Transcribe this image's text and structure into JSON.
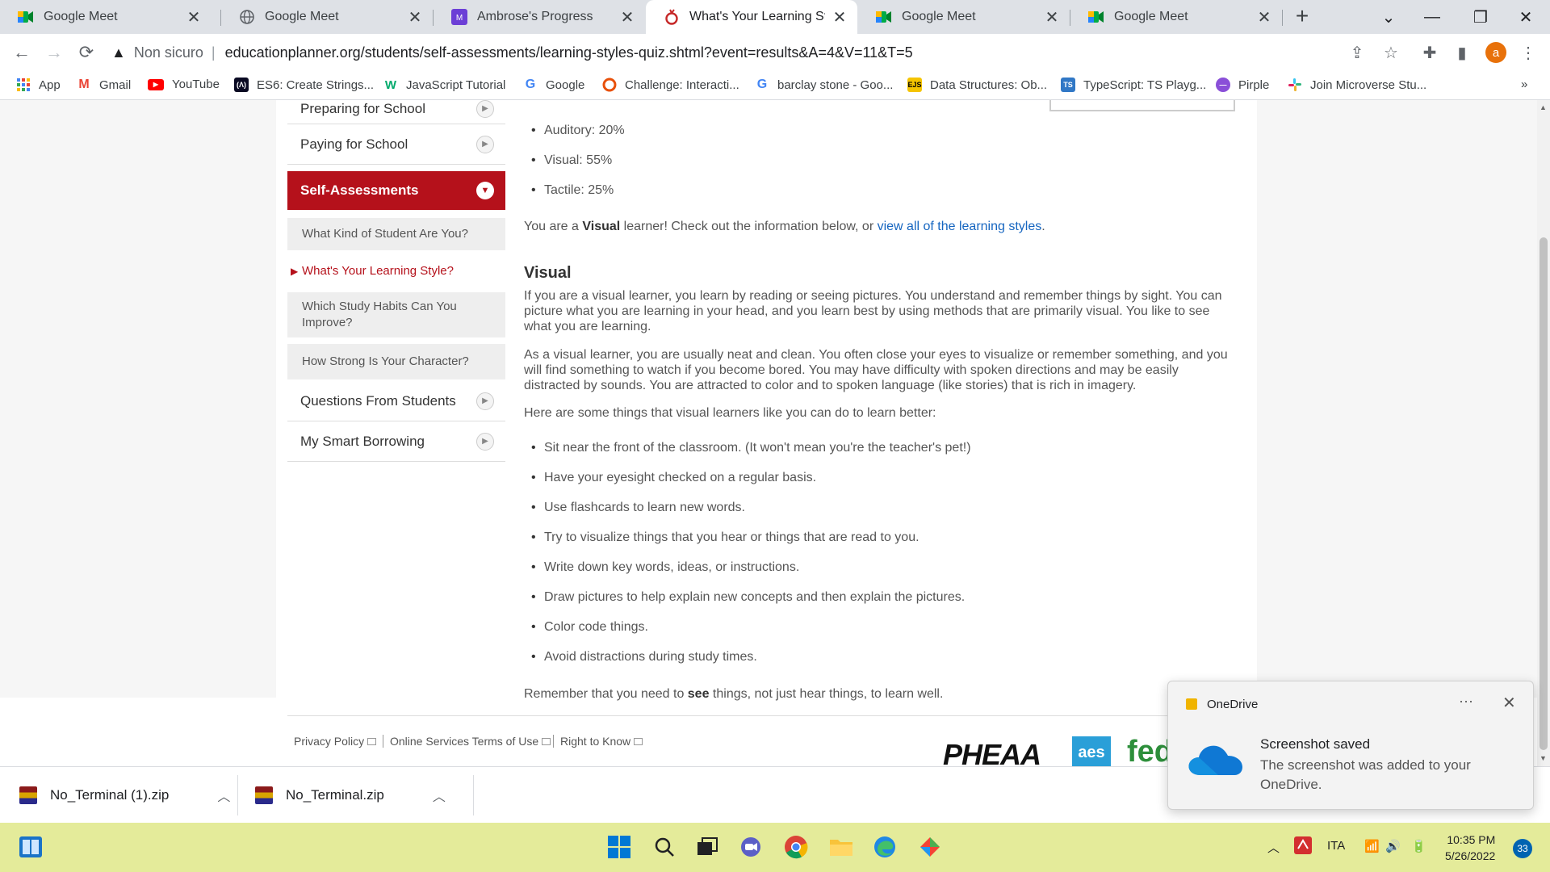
{
  "browser": {
    "tabs": [
      {
        "title": "Google Meet",
        "icon": "google-meet-icon"
      },
      {
        "title": "Google Meet",
        "icon": "globe-icon"
      },
      {
        "title": "Ambrose's Progress",
        "icon": "mm-icon"
      },
      {
        "title": "What's Your Learning Style?",
        "icon": "educationplanner-icon",
        "active": true
      },
      {
        "title": "Google Meet",
        "icon": "google-meet-icon"
      },
      {
        "title": "Google Meet",
        "icon": "google-meet-icon"
      }
    ],
    "security_label": "Non sicuro",
    "url": "educationplanner.org/students/self-assessments/learning-styles-quiz.shtml?event=results&A=4&V=11&T=5",
    "profile_initial": "a",
    "bookmarks": [
      {
        "label": "App",
        "icon": "apps-grid-icon"
      },
      {
        "label": "Gmail",
        "icon": "gmail-icon"
      },
      {
        "label": "YouTube",
        "icon": "youtube-icon"
      },
      {
        "label": "ES6: Create Strings...",
        "icon": "freecodecamp-icon"
      },
      {
        "label": "JavaScript Tutorial",
        "icon": "w3schools-icon"
      },
      {
        "label": "Google",
        "icon": "google-icon"
      },
      {
        "label": "Challenge: Interacti...",
        "icon": "khan-icon"
      },
      {
        "label": "barclay stone - Goo...",
        "icon": "google-icon"
      },
      {
        "label": "Data Structures: Ob...",
        "icon": "ejs-icon"
      },
      {
        "label": "TypeScript: TS Playg...",
        "icon": "typescript-icon"
      },
      {
        "label": "Pirple",
        "icon": "pirple-icon"
      },
      {
        "label": "Join Microverse Stu...",
        "icon": "slack-icon"
      }
    ],
    "bookmarks_overflow": "»"
  },
  "sidebar": {
    "items": [
      {
        "label": "Preparing for School"
      },
      {
        "label": "Paying for School"
      },
      {
        "label": "Self-Assessments",
        "active": true
      }
    ],
    "sub_items": [
      {
        "label": "What Kind of Student Are You?"
      },
      {
        "label": "What's Your Learning Style?",
        "current": true
      },
      {
        "label": "Which Study Habits Can You Improve?"
      },
      {
        "label": "How Strong Is Your Character?"
      }
    ],
    "after_items": [
      {
        "label": "Questions From Students"
      },
      {
        "label": "My Smart Borrowing"
      }
    ]
  },
  "results": {
    "scores": [
      "Auditory: 20%",
      "Visual: 55%",
      "Tactile: 25%"
    ],
    "summary_pre": "You are a ",
    "summary_bold": "Visual",
    "summary_mid": " learner! Check out the information below, or ",
    "summary_link": "view all of the learning styles",
    "summary_post": "."
  },
  "visual": {
    "heading": "Visual",
    "p1": "If you are a visual learner, you learn by reading or seeing pictures. You understand and remember things by sight. You can picture what you are learning in your head, and you learn best by using methods that are primarily visual. You like to see what you are learning.",
    "p2": "As a visual learner, you are usually neat and clean. You often close your eyes to visualize or remember something, and you will find something to watch if you become bored. You may have difficulty with spoken directions and may be easily distracted by sounds. You are attracted to color and to spoken language (like stories) that is rich in imagery.",
    "p3": "Here are some things that visual learners like you can do to learn better:",
    "tips": [
      "Sit near the front of the classroom. (It won't mean you're the teacher's pet!)",
      "Have your eyesight checked on a regular basis.",
      "Use flashcards to learn new words.",
      "Try to visualize things that you hear or things that are read to you.",
      "Write down key words, ideas, or instructions.",
      "Draw pictures to help explain new concepts and then explain the pictures.",
      "Color code things.",
      "Avoid distractions during study times."
    ],
    "closing_pre": "Remember that you need to ",
    "closing_bold": "see",
    "closing_post": " things, not just hear things, to learn well."
  },
  "footer": {
    "links": [
      "Privacy Policy",
      "Online Services Terms of Use",
      "Right to Know"
    ],
    "logos": [
      "PHEAA",
      "aes",
      "fed"
    ]
  },
  "downloads": [
    {
      "name": "No_Terminal (1).zip"
    },
    {
      "name": "No_Terminal.zip"
    }
  ],
  "toast": {
    "app": "OneDrive",
    "dots": "···",
    "title": "Screenshot saved",
    "message": "The screenshot was added to your OneDrive."
  },
  "taskbar": {
    "language": "ITA",
    "time": "10:35 PM",
    "date": "5/26/2022",
    "notifications": "33"
  },
  "colors": {
    "accent_red": "#b5111b",
    "link_blue": "#1565c0",
    "taskbar": "#e4eb9a"
  }
}
